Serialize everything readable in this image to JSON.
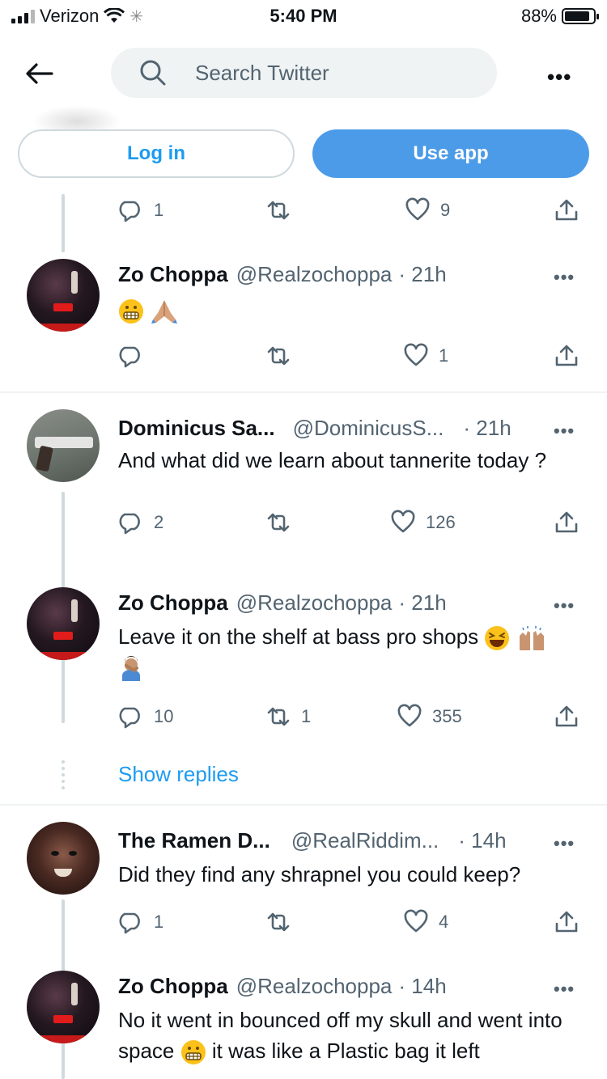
{
  "status_bar": {
    "carrier": "Verizon",
    "time": "5:40 PM",
    "battery": "88%",
    "battery_level": 0.88
  },
  "header": {
    "search_placeholder": "Search Twitter",
    "login_label": "Log in",
    "use_app_label": "Use app",
    "more_label": "•••"
  },
  "top_actions": {
    "reply": "1",
    "retweet": "",
    "like": "9"
  },
  "tweets": [
    {
      "name": "Zo Choppa",
      "handle": "@Realzochoppa",
      "time": "· 21h",
      "text": "",
      "reply": "",
      "retweet": "",
      "like": "1"
    },
    {
      "name": "Dominicus Sa...",
      "handle": "@DominicusS...",
      "time": "· 21h",
      "text": "And what did we learn about tannerite today ?",
      "reply": "2",
      "retweet": "",
      "like": "126"
    },
    {
      "name": "Zo Choppa",
      "handle": "@Realzochoppa",
      "time": "· 21h",
      "text": "Leave it on the shelf at bass pro shops",
      "reply": "10",
      "retweet": "1",
      "like": "355"
    },
    {
      "name": "The Ramen D...",
      "handle": "@RealRiddim...",
      "time": "· 14h",
      "text": "Did they find any shrapnel you could keep?",
      "reply": "1",
      "retweet": "",
      "like": "4"
    },
    {
      "name": "Zo Choppa",
      "handle": "@Realzochoppa",
      "time": "· 14h",
      "text_a": "No it went in bounced off my skull and went into space",
      "text_b": "it was like a Plastic  bag it left"
    }
  ],
  "show_replies_label": "Show replies",
  "colors": {
    "accent": "#1d9bf0",
    "app_button": "#4c9be8",
    "muted": "#536471"
  }
}
